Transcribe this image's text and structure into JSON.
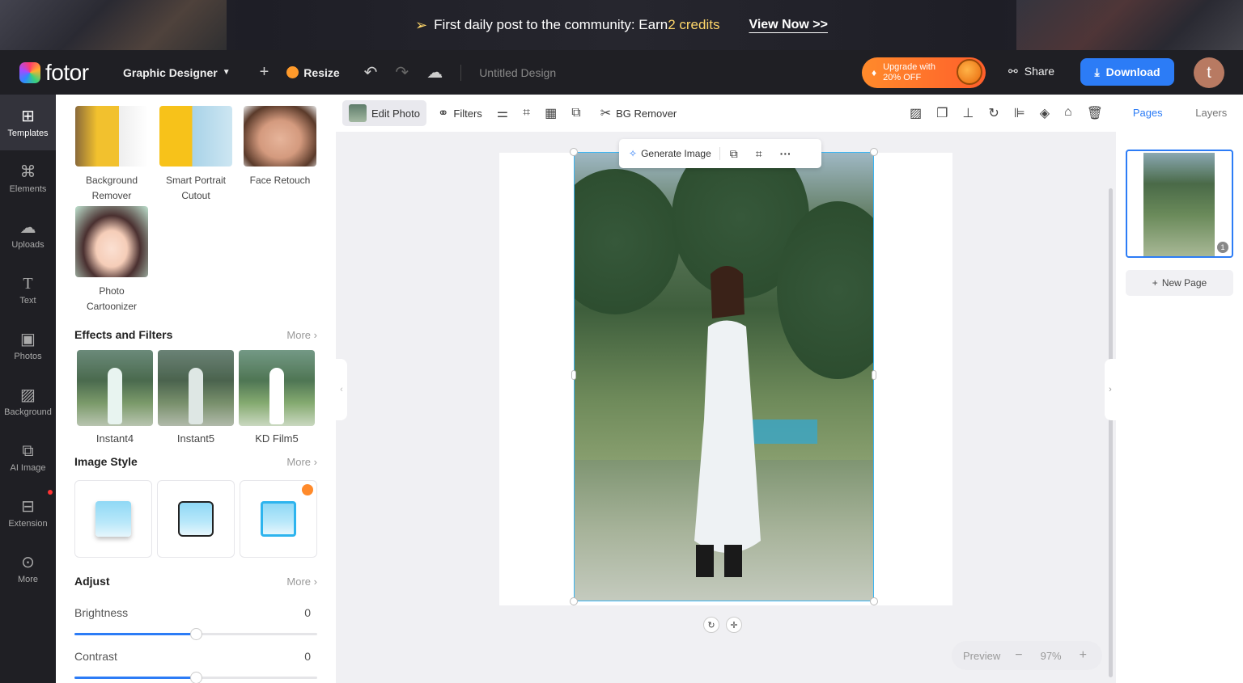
{
  "banner": {
    "message_prefix": "First daily post to the community: Earn ",
    "credits": "2 credits",
    "link": "View Now >>"
  },
  "topbar": {
    "logo": "fotor",
    "workspace": "Graphic Designer",
    "resize": "Resize",
    "doc_title": "Untitled Design",
    "upgrade_line1": "Upgrade with",
    "upgrade_line2": "20% OFF",
    "share": "Share",
    "download": "Download",
    "avatar_initial": "t"
  },
  "rail": {
    "items": [
      {
        "label": "Templates",
        "icon": "templates-icon"
      },
      {
        "label": "Elements",
        "icon": "elements-icon"
      },
      {
        "label": "Uploads",
        "icon": "uploads-icon"
      },
      {
        "label": "Text",
        "icon": "text-icon"
      },
      {
        "label": "Photos",
        "icon": "photos-icon"
      },
      {
        "label": "Background",
        "icon": "background-icon"
      },
      {
        "label": "AI Image",
        "icon": "ai-image-icon"
      },
      {
        "label": "Extension",
        "icon": "extension-icon"
      },
      {
        "label": "More",
        "icon": "more-icon"
      }
    ]
  },
  "tools": [
    {
      "label": "Background Remover"
    },
    {
      "label": "Smart Portrait Cutout"
    },
    {
      "label": "Face Retouch"
    },
    {
      "label": "Photo Cartoonizer"
    }
  ],
  "effects": {
    "title": "Effects and Filters",
    "more": "More",
    "items": [
      "Instant4",
      "Instant5",
      "KD Film5"
    ]
  },
  "image_style": {
    "title": "Image Style",
    "more": "More"
  },
  "adjust": {
    "title": "Adjust",
    "more": "More",
    "brightness_label": "Brightness",
    "brightness_value": "0",
    "contrast_label": "Contrast",
    "contrast_value": "0",
    "brightness_level": 0.5,
    "contrast_level": 0.5
  },
  "toolbar": {
    "edit_photo": "Edit Photo",
    "filters": "Filters",
    "bg_remover": "BG Remover"
  },
  "float_bar": {
    "generate": "Generate Image"
  },
  "zoom": {
    "preview": "Preview",
    "level": "97%"
  },
  "right_panel": {
    "tab_pages": "Pages",
    "tab_layers": "Layers",
    "page_number": "1",
    "new_page": "New Page"
  },
  "colors": {
    "accent": "#2c7cf6",
    "selection": "#3ab4f2",
    "upgrade": "#ff7a2b"
  }
}
